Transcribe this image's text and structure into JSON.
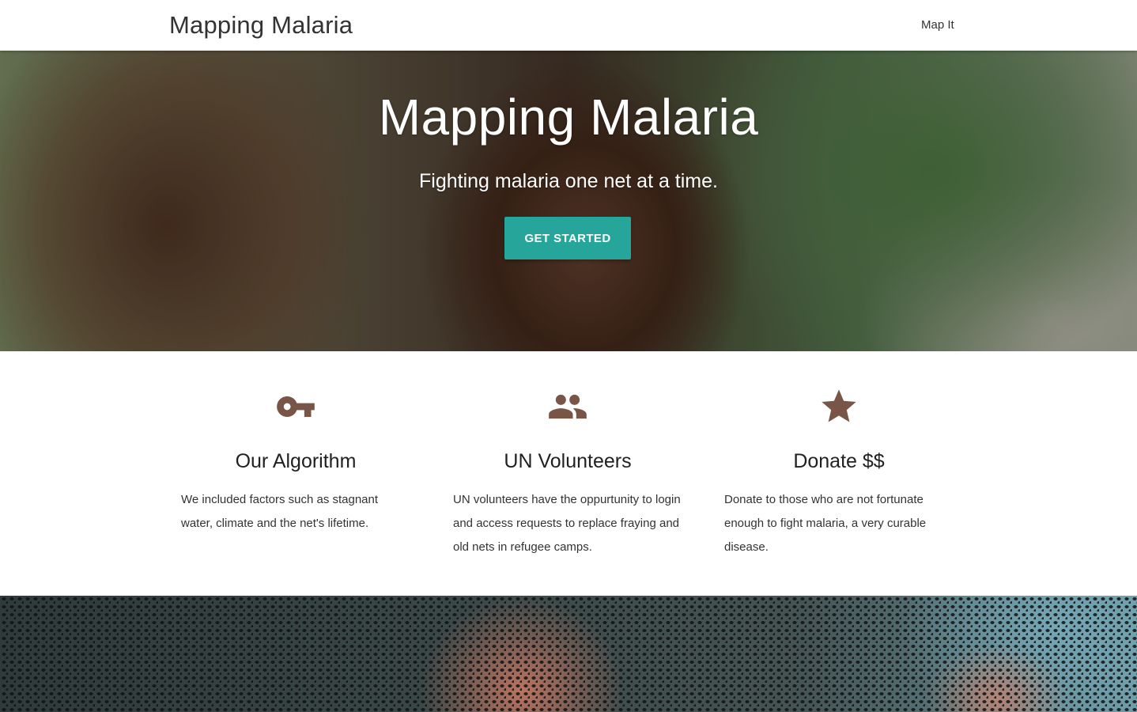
{
  "header": {
    "brand": "Mapping Malaria",
    "nav_link": "Map It"
  },
  "hero": {
    "title": "Mapping Malaria",
    "subtitle": "Fighting malaria one net at a time.",
    "cta_label": "GET STARTED"
  },
  "features": [
    {
      "icon": "key-icon",
      "title": "Our Algorithm",
      "text": "We included factors such as stagnant water, climate and the net's lifetime."
    },
    {
      "icon": "people-icon",
      "title": "UN Volunteers",
      "text": "UN volunteers have the oppurtunity to login and access requests to replace fraying and old nets in refugee camps."
    },
    {
      "icon": "star-icon",
      "title": "Donate $$",
      "text": "Donate to those who are not fortunate enough to fight malaria, a very curable disease."
    }
  ],
  "colors": {
    "accent": "#26a69a",
    "icon": "#795548",
    "header_bg": "#ffffff"
  }
}
